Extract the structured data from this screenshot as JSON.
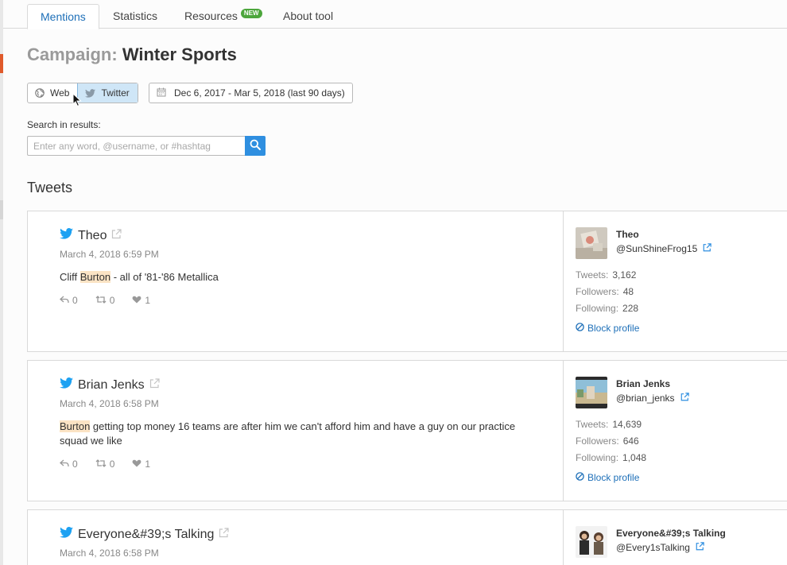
{
  "tabs": [
    {
      "label": "Mentions"
    },
    {
      "label": "Statistics"
    },
    {
      "label": "Resources",
      "badge": "NEW"
    },
    {
      "label": "About tool"
    }
  ],
  "campaign": {
    "prefix": "Campaign:",
    "name": "Winter Sports"
  },
  "filters": {
    "source_web": "Web",
    "source_twitter": "Twitter",
    "date_range": "Dec 6, 2017 - Mar 5, 2018 (last 90 days)"
  },
  "search": {
    "label": "Search in results:",
    "placeholder": "Enter any word, @username, or #hashtag"
  },
  "section_title": "Tweets",
  "colors": {
    "accent": "#1d6fb8",
    "twitter": "#1da1f2",
    "highlight": "#fbe3c4",
    "search_button": "#2f8fe0"
  },
  "tweets": [
    {
      "author": "Theo",
      "time": "March 4, 2018 6:59 PM",
      "text_pre": "Cliff ",
      "highlight": "Burton",
      "text_post": " - all of '81-'86 Metallica",
      "replies": "0",
      "retweets": "0",
      "likes": "1",
      "profile": {
        "name": "Theo",
        "handle": "@SunShineFrog15",
        "tweets_label": "Tweets:",
        "tweets": "3,162",
        "followers_label": "Followers:",
        "followers": "48",
        "following_label": "Following:",
        "following": "228",
        "block_label": "Block profile"
      }
    },
    {
      "author": "Brian Jenks",
      "time": "March 4, 2018 6:58 PM",
      "text_pre": "",
      "highlight": "Burton",
      "text_post": " getting top money 16 teams are after him we can't afford him and have a guy on our practice squad we like",
      "replies": "0",
      "retweets": "0",
      "likes": "1",
      "profile": {
        "name": "Brian Jenks",
        "handle": "@brian_jenks",
        "tweets_label": "Tweets:",
        "tweets": "14,639",
        "followers_label": "Followers:",
        "followers": "646",
        "following_label": "Following:",
        "following": "1,048",
        "block_label": "Block profile"
      }
    },
    {
      "author": "Everyone&#39;s Talking",
      "time": "March 4, 2018 6:58 PM",
      "profile": {
        "name": "Everyone&#39;s Talking",
        "handle": "@Every1sTalking"
      }
    }
  ]
}
